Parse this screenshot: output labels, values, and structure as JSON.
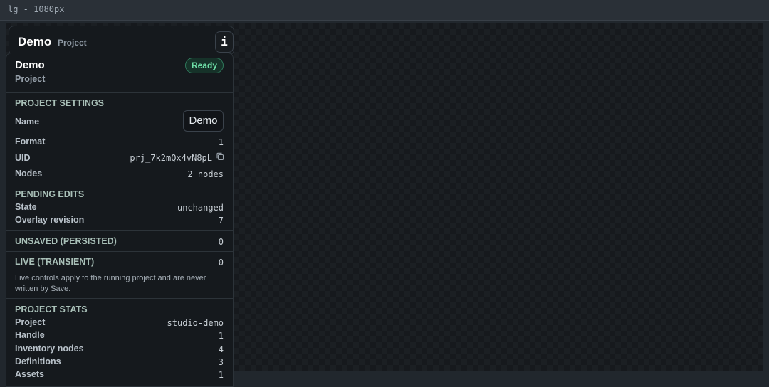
{
  "window": {
    "title": "lg - 1080px"
  },
  "project_header": {
    "title": "Demo",
    "subtitle": "Project",
    "info_label": "i"
  },
  "panel": {
    "title": "Demo",
    "subtitle": "Project",
    "status_badge": "Ready",
    "status_color": "#6fe0a8",
    "project_settings": {
      "heading": "PROJECT SETTINGS",
      "name_label": "Name",
      "name_value": "Demo",
      "format_label": "Format",
      "format_value": "1",
      "uid_label": "UID",
      "uid_value": "prj_7k2mQx4vN8pL",
      "uid_icon": "copy-icon",
      "nodes_label": "Nodes",
      "nodes_value": "2 nodes"
    },
    "pending_edits": {
      "heading": "PENDING EDITS",
      "state_label": "State",
      "state_value": "unchanged",
      "overlay_label": "Overlay revision",
      "overlay_value": "7"
    },
    "unsaved": {
      "heading": "UNSAVED (PERSISTED)",
      "value": "0"
    },
    "live": {
      "heading": "LIVE (TRANSIENT)",
      "value": "0",
      "note": "Live controls apply to the running project and are never written by Save."
    },
    "project_stats": {
      "heading": "PROJECT STATS",
      "project_label": "Project",
      "project_value": "studio-demo",
      "handle_label": "Handle",
      "handle_value": "1",
      "inventory_label": "Inventory nodes",
      "inventory_value": "4",
      "definitions_label": "Definitions",
      "definitions_value": "3",
      "assets_label": "Assets",
      "assets_value": "1"
    }
  }
}
